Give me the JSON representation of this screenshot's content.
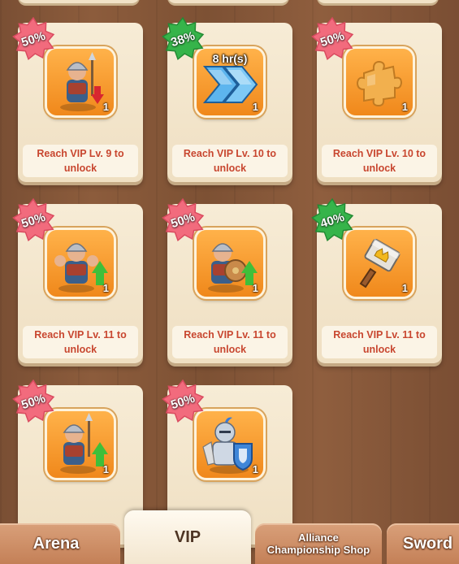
{
  "colors": {
    "badge_red": "#f26b7d",
    "badge_green": "#36b44a",
    "lock_text": "#c8462f",
    "tile_orange": "#f59a2a"
  },
  "cards": [
    {
      "discount": "50%",
      "badge": "red",
      "icon": "soldier-attack-down-icon",
      "qty": "1",
      "lock": "Reach VIP Lv. 9 to\nunlock"
    },
    {
      "discount": "38%",
      "badge": "green",
      "icon": "speedup-chevrons-icon",
      "timer": "8 hr(s)",
      "qty": "1",
      "lock": "Reach VIP Lv. 10 to\nunlock"
    },
    {
      "discount": "50%",
      "badge": "red",
      "icon": "puzzle-piece-icon",
      "qty": "1",
      "lock": "Reach VIP Lv. 10 to\nunlock"
    },
    {
      "discount": "50%",
      "badge": "red",
      "icon": "soldier-strength-up-icon",
      "qty": "1",
      "lock": "Reach VIP Lv. 11 to\nunlock"
    },
    {
      "discount": "50%",
      "badge": "red",
      "icon": "soldier-shield-up-icon",
      "qty": "1",
      "lock": "Reach VIP Lv. 11 to\nunlock"
    },
    {
      "discount": "40%",
      "badge": "green",
      "icon": "hammer-icon",
      "qty": "1",
      "lock": "Reach VIP Lv. 11 to\nunlock"
    },
    {
      "discount": "50%",
      "badge": "red",
      "icon": "soldier-attack-up-icon",
      "qty": "1"
    },
    {
      "discount": "50%",
      "badge": "red",
      "icon": "knight-shield-icon",
      "qty": "1"
    }
  ],
  "tabs": [
    {
      "label": "Arena"
    },
    {
      "label": "VIP",
      "active": true
    },
    {
      "label": "Alliance\nChampionship Shop"
    },
    {
      "label": "Sword"
    }
  ]
}
